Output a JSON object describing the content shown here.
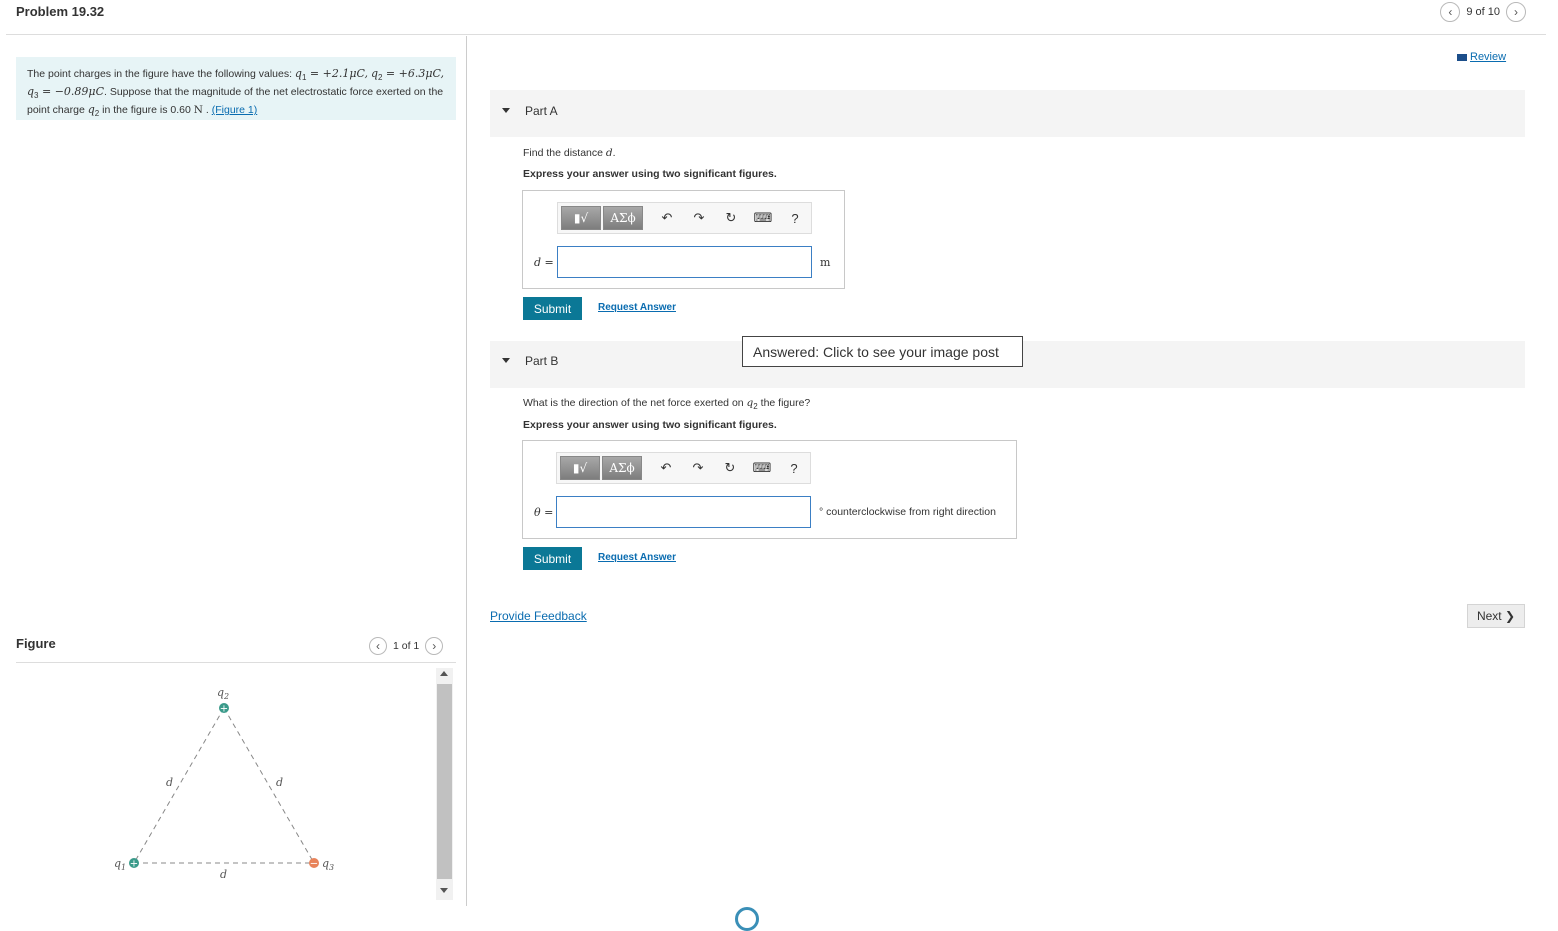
{
  "header": {
    "title": "Problem 19.32",
    "pager": "9 of 10",
    "review_label": "Review"
  },
  "problem": {
    "text_1": "The point charges in the figure have the following values: ",
    "q1": "q",
    "q1_sub": "1",
    "q1_val": " = +2.1μC,",
    "q2": "q",
    "q2_sub": "2",
    "q2_val": " = +6.3μC, ",
    "q3": "q",
    "q3_sub": "3",
    "q3_val": " = −0.89μC",
    "text_2": ". Suppose that the magnitude of the net electrostatic force exerted on the point charge ",
    "text_q2": "q",
    "text_q2_sub": "2",
    "text_3": " in the figure is 0.60 ",
    "force_unit": "N",
    "text_4": " . ",
    "figure_link": "(Figure 1)"
  },
  "part_a": {
    "label": "Part A",
    "question_pre": "Find the distance ",
    "question_var": "d",
    "question_post": ".",
    "instruction": "Express your answer using two significant figures.",
    "var_label": "d =",
    "unit": "m",
    "submit": "Submit",
    "request": "Request Answer"
  },
  "part_b": {
    "label": "Part B",
    "question_pre": "What is the direction of the net force exerted on ",
    "question_var": "q",
    "question_sub": "2",
    "question_post": " the figure?",
    "instruction": "Express your answer using two significant figures.",
    "var_label": "θ =",
    "unit": "° counterclockwise from right direction",
    "submit": "Submit",
    "request": "Request Answer"
  },
  "toolbar": {
    "templates": "▮√",
    "greek": "ΑΣϕ",
    "undo": "↶",
    "redo": "↷",
    "reset": "↻",
    "keyboard": "⌨",
    "help": "?"
  },
  "overlay": {
    "answered": "Answered: Click to see your image post"
  },
  "footer": {
    "feedback": "Provide Feedback",
    "next": "Next ❯"
  },
  "figure": {
    "heading": "Figure",
    "pager": "1 of 1",
    "labels": {
      "q1": "q",
      "q1_sub": "1",
      "q2": "q",
      "q2_sub": "2",
      "q3": "q",
      "q3_sub": "3",
      "d_left": "d",
      "d_right": "d",
      "d_bottom": "d"
    },
    "colors": {
      "positive": "#3a9a8a",
      "negative": "#e8835a",
      "line": "#888888"
    }
  }
}
